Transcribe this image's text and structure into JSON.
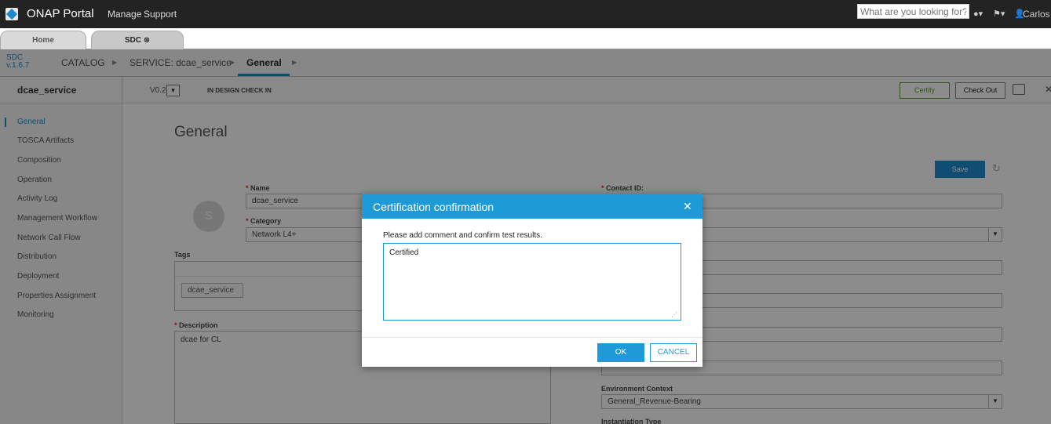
{
  "topbar": {
    "title": "ONAP Portal",
    "nav": [
      "Manage",
      "Support"
    ],
    "search_placeholder": "What are you looking for?",
    "user_name": "Carlos"
  },
  "tabs": [
    {
      "label": "Home"
    },
    {
      "label": "SDC ⊗"
    }
  ],
  "breadcrumb": {
    "app": "SDC",
    "version": "v.1.6.7",
    "items": [
      "CATALOG",
      "SERVICE: dcae_service",
      "General"
    ]
  },
  "service_header": {
    "name": "dcae_service",
    "version": "V0.2",
    "status": "IN DESIGN CHECK IN",
    "certify_label": "Certify",
    "checkout_label": "Check Out"
  },
  "left_nav": {
    "items": [
      "General",
      "TOSCA Artifacts",
      "Composition",
      "Operation",
      "Activity Log",
      "Management Workflow",
      "Network Call Flow",
      "Distribution",
      "Deployment",
      "Properties Assignment",
      "Monitoring"
    ],
    "active": "General"
  },
  "form": {
    "heading": "General",
    "save_label": "Save",
    "avatar_letter": "S",
    "name_label": "Name",
    "name_value": "dcae_service",
    "category_label": "Category",
    "category_value": "Network L4+",
    "tags_label": "Tags",
    "tag_chip": "dcae_service",
    "description_label": "Description",
    "description_value": "dcae for CL",
    "contact_label": "Contact ID:",
    "env_context_label": "Environment Context",
    "env_context_value": "General_Revenue-Bearing",
    "instantiation_label": "Instantiation Type"
  },
  "modal": {
    "title": "Certification confirmation",
    "instruction": "Please add comment and confirm test results.",
    "comment_value": "Certified",
    "ok_label": "OK",
    "cancel_label": "CANCEL"
  },
  "colors": {
    "accent": "#1e9bd7",
    "topbar": "#232323",
    "certify": "#5aa02c"
  }
}
